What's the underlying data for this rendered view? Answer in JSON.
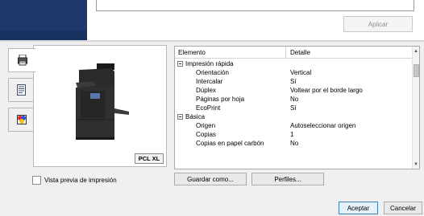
{
  "top": {
    "apply_label": "Aplicar"
  },
  "preview": {
    "badge": "PCL XL",
    "checkbox_label": "Vista previa de impresión"
  },
  "grid": {
    "col_element": "Elemento",
    "col_detail": "Detalle",
    "rows": [
      {
        "label": "Impresión rápida",
        "value": "",
        "group": true
      },
      {
        "label": "Orientación",
        "value": "Vertical",
        "group": false
      },
      {
        "label": "Intercalar",
        "value": "Sí",
        "group": false
      },
      {
        "label": "Dúplex",
        "value": "Voltear por el borde largo",
        "group": false
      },
      {
        "label": "Páginas por hoja",
        "value": "No",
        "group": false
      },
      {
        "label": "EcoPrint",
        "value": "Sí",
        "group": false
      },
      {
        "label": "Básica",
        "value": "",
        "group": true
      },
      {
        "label": "Origen",
        "value": "Autoseleccionar origen",
        "group": false
      },
      {
        "label": "Copias",
        "value": "1",
        "group": false
      },
      {
        "label": "Copias en papel carbón",
        "value": "No",
        "group": false
      }
    ]
  },
  "buttons": {
    "save_as": "Guardar como...",
    "profiles": "Perfiles...",
    "accept": "Aceptar",
    "cancel": "Cancelar"
  },
  "icons": {
    "tab1": "printer-icon",
    "tab2": "document-icon",
    "tab3": "color-image-icon"
  },
  "colors": {
    "header_navy": "#1d3a6b",
    "accept_border": "#3c7fb1"
  }
}
